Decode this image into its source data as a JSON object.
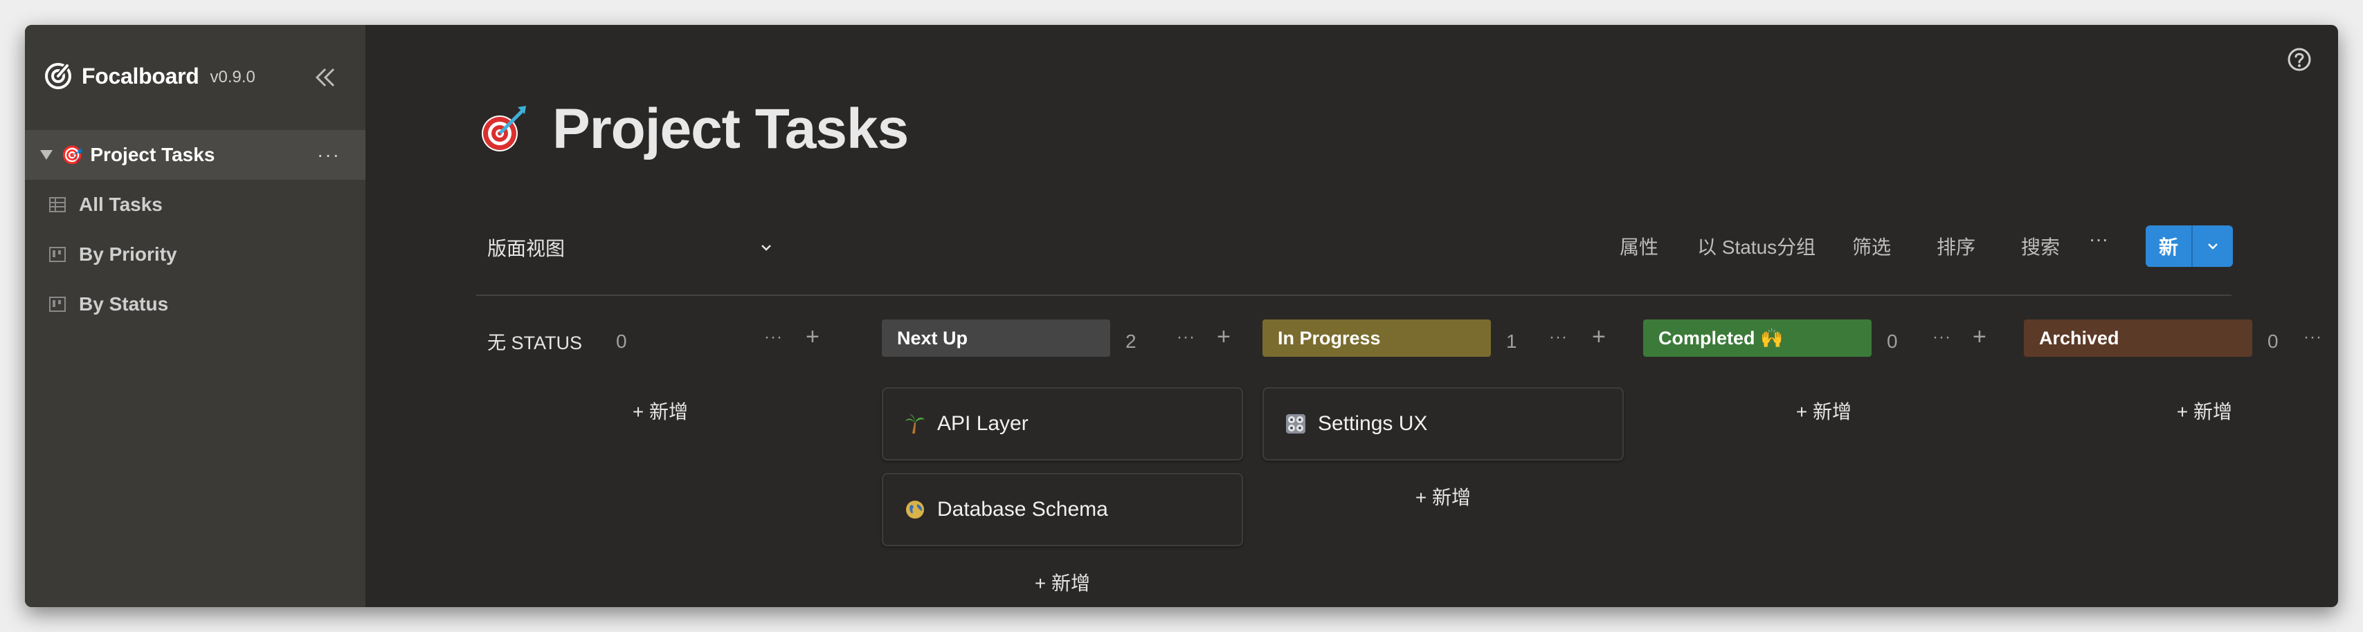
{
  "app": {
    "name": "Focalboard",
    "version": "v0.9.0"
  },
  "sidebar": {
    "board": {
      "emoji": "🎯",
      "label": "Project Tasks",
      "more": "···"
    },
    "views": [
      {
        "label": "All Tasks",
        "icon": "table-icon"
      },
      {
        "label": "By Priority",
        "icon": "board-icon"
      },
      {
        "label": "By Status",
        "icon": "board-icon"
      }
    ]
  },
  "board": {
    "title": "Project Tasks",
    "icon": "dart-target-icon"
  },
  "toolbar": {
    "view_name": "版面视图",
    "properties": "属性",
    "group_by": "以 Status分组",
    "filter": "筛选",
    "sort": "排序",
    "search": "搜索",
    "more": "···",
    "new_label": "新"
  },
  "columns": [
    {
      "name": "无 STATUS",
      "color": null,
      "count": "0",
      "cards": [],
      "add_label": "+ 新增"
    },
    {
      "name": "Next Up",
      "color": "#454545",
      "count": "2",
      "cards": [
        {
          "title": "API Layer",
          "icon": "palm-tree-icon"
        },
        {
          "title": "Database Schema",
          "icon": "globe-icon"
        }
      ],
      "add_label": "+ 新增"
    },
    {
      "name": "In Progress",
      "color": "#7a6c2e",
      "count": "1",
      "cards": [
        {
          "title": "Settings UX",
          "icon": "control-knobs-icon"
        }
      ],
      "add_label": "+ 新增"
    },
    {
      "name": "Completed 🙌",
      "color": "#3c7a39",
      "count": "0",
      "cards": [],
      "add_label": "+ 新增"
    },
    {
      "name": "Archived",
      "color": "#5c3a28",
      "count": "0",
      "cards": [],
      "add_label": "+ 新增"
    }
  ],
  "column_more": "···",
  "column_add": "+"
}
